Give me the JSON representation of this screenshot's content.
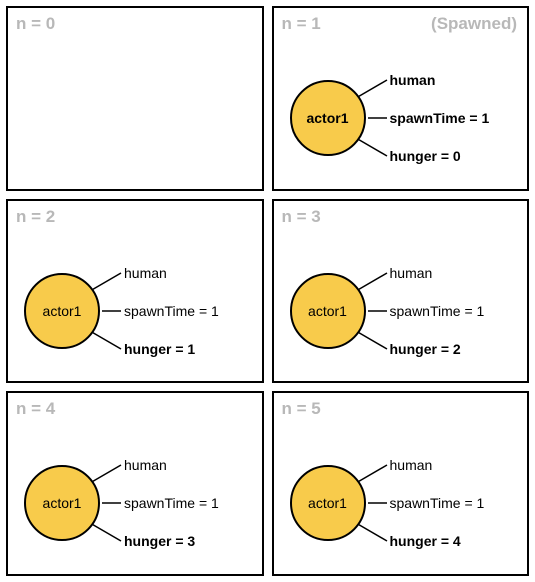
{
  "panels": [
    {
      "step": "n = 0",
      "note": "",
      "actor": null
    },
    {
      "step": "n = 1",
      "note": "(Spawned)",
      "actor": {
        "name": "actor1",
        "name_bold": true,
        "props": [
          {
            "text": "human",
            "bold": true
          },
          {
            "text": "spawnTime = 1",
            "bold": true
          },
          {
            "text": "hunger = 0",
            "bold": true
          }
        ]
      }
    },
    {
      "step": "n = 2",
      "note": "",
      "actor": {
        "name": "actor1",
        "name_bold": false,
        "props": [
          {
            "text": "human",
            "bold": false
          },
          {
            "text": "spawnTime = 1",
            "bold": false
          },
          {
            "text": "hunger = 1",
            "bold": true
          }
        ]
      }
    },
    {
      "step": "n = 3",
      "note": "",
      "actor": {
        "name": "actor1",
        "name_bold": false,
        "props": [
          {
            "text": "human",
            "bold": false
          },
          {
            "text": "spawnTime = 1",
            "bold": false
          },
          {
            "text": "hunger = 2",
            "bold": true
          }
        ]
      }
    },
    {
      "step": "n = 4",
      "note": "",
      "actor": {
        "name": "actor1",
        "name_bold": false,
        "props": [
          {
            "text": "human",
            "bold": false
          },
          {
            "text": "spawnTime = 1",
            "bold": false
          },
          {
            "text": "hunger = 3",
            "bold": true
          }
        ]
      }
    },
    {
      "step": "n = 5",
      "note": "",
      "actor": {
        "name": "actor1",
        "name_bold": false,
        "props": [
          {
            "text": "human",
            "bold": false
          },
          {
            "text": "spawnTime = 1",
            "bold": false
          },
          {
            "text": "hunger = 4",
            "bold": true
          }
        ]
      }
    }
  ],
  "colors": {
    "circle_fill": "#f8cb4b",
    "muted_text": "#b8b8b8"
  }
}
